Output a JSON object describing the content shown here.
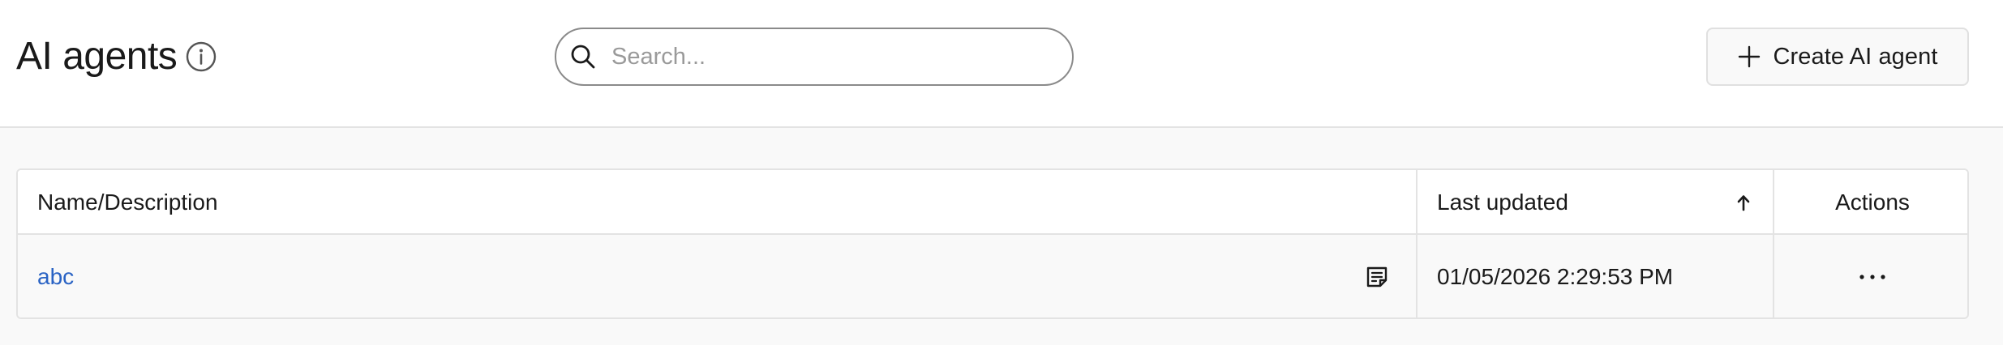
{
  "header": {
    "title": "AI agents",
    "info_icon": "info-icon",
    "search": {
      "placeholder": "Search...",
      "value": "",
      "icon": "search-icon"
    },
    "create_button": {
      "label": "Create AI agent",
      "icon": "plus-icon"
    }
  },
  "table": {
    "columns": [
      {
        "label": "Name/Description"
      },
      {
        "label": "Last updated",
        "sort": "ascending",
        "sort_icon": "arrow-up-icon"
      },
      {
        "label": "Actions"
      }
    ],
    "rows": [
      {
        "name": "abc",
        "description_icon": "notes-icon",
        "last_updated": "01/05/2026 2:29:53 PM",
        "actions_icon": "more-horizontal-icon"
      }
    ]
  },
  "colors": {
    "link": "#2a63c4",
    "border": "#e3e3e3",
    "page_background": "#f9f9f9",
    "header_background": "#ffffff",
    "text": "#1a1a1a"
  }
}
